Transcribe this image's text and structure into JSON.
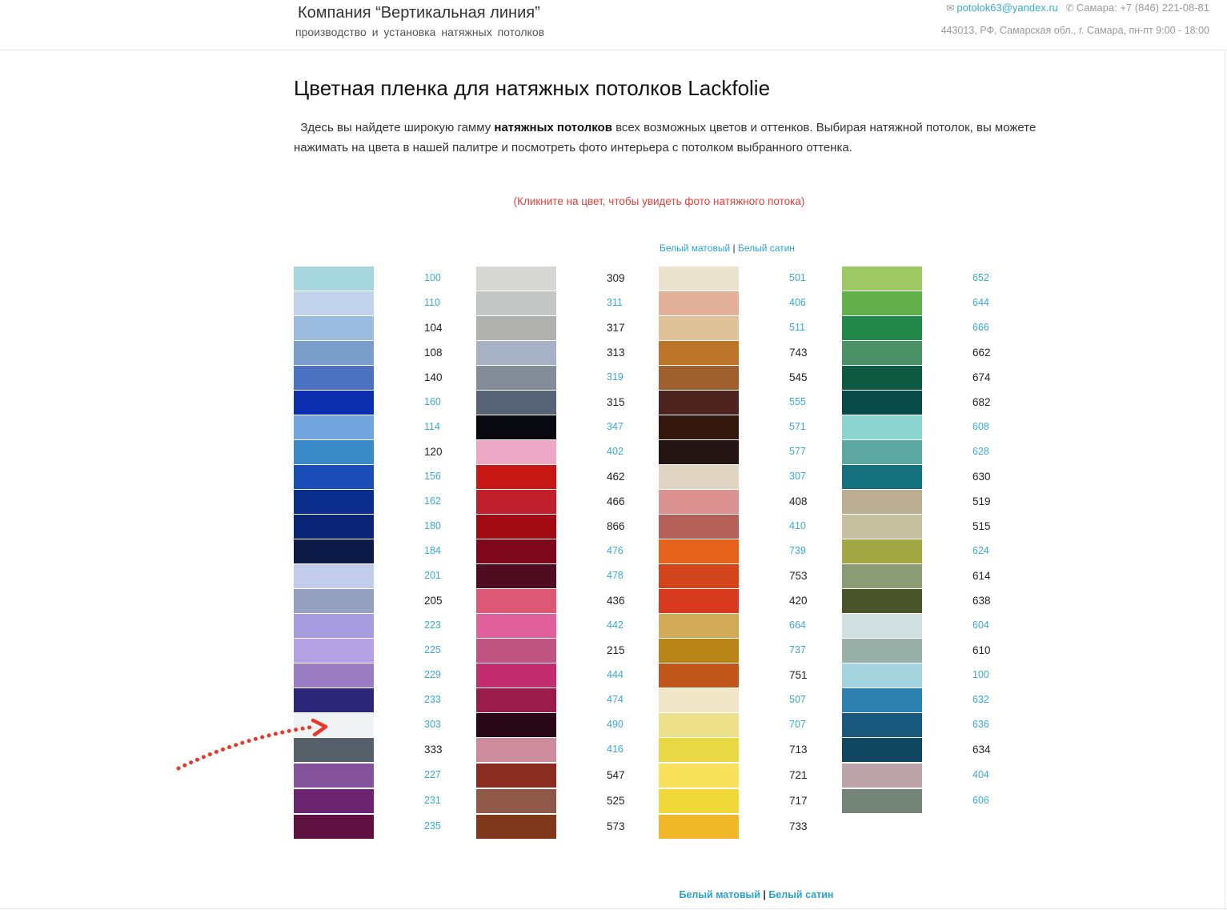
{
  "header": {
    "company": "Компания “Вертикальная линия”",
    "tagline": "производство и установка натяжных потолков",
    "email": "potolok63@yandex.ru",
    "phone": "Самара: +7 (846) 221-08-81",
    "address": "443013, РФ, Самарская обл., г. Самара, пн-пт 9:00 - 18:00"
  },
  "page": {
    "title": "Цветная пленка для натяжных потолков Lackfolie",
    "intro_before": "  Здесь вы найдете широкую гамму ",
    "intro_bold": "натяжных потолков",
    "intro_after": " всех возможных цветов и оттенков. Выбирая натяжной потолок, вы можете нажимать на цвета в нашей палитре и посмотреть фото интерьера с потолком выбранного оттенка.",
    "hint": "(Кликните на цвет, чтобы увидеть фото натяжного потока)",
    "white_matte": "Белый матовый",
    "white_satin": "Белый сатин",
    "separator": "|"
  },
  "palette": {
    "columns": [
      [
        {
          "code": "100",
          "color": "#a6d6de",
          "link": true
        },
        {
          "code": "110",
          "color": "#c2d3ec",
          "link": true
        },
        {
          "code": "104",
          "color": "#9cbce0",
          "link": false
        },
        {
          "code": "108",
          "color": "#7a9dc9",
          "link": false
        },
        {
          "code": "140",
          "color": "#4a72c0",
          "link": false
        },
        {
          "code": "160",
          "color": "#0e30b0",
          "link": true
        },
        {
          "code": "114",
          "color": "#72a4e0",
          "link": true
        },
        {
          "code": "120",
          "color": "#3a8ac8",
          "link": false
        },
        {
          "code": "156",
          "color": "#1a4db8",
          "link": true
        },
        {
          "code": "162",
          "color": "#0a2c8a",
          "link": true
        },
        {
          "code": "180",
          "color": "#0a2478",
          "link": true
        },
        {
          "code": "184",
          "color": "#0c1a48",
          "link": true
        },
        {
          "code": "201",
          "color": "#c2cdee",
          "link": true
        },
        {
          "code": "205",
          "color": "#94a0c0",
          "link": false
        },
        {
          "code": "223",
          "color": "#a89ce0",
          "link": true
        },
        {
          "code": "225",
          "color": "#b4a2e4",
          "link": true
        },
        {
          "code": "229",
          "color": "#9a7cc4",
          "link": true
        },
        {
          "code": "233",
          "color": "#2c2678",
          "link": true
        },
        {
          "code": "303",
          "color": "#f0f3f4",
          "link": true
        },
        {
          "code": "333",
          "color": "#56606a",
          "link": false
        },
        {
          "code": "227",
          "color": "#84529a",
          "link": true
        },
        {
          "code": "231",
          "color": "#6a2470",
          "link": true
        },
        {
          "code": "235",
          "color": "#5e1040",
          "link": true
        }
      ],
      [
        {
          "code": "309",
          "color": "#d6d6d4",
          "link": false
        },
        {
          "code": "311",
          "color": "#c4c6c6",
          "link": true
        },
        {
          "code": "317",
          "color": "#b0b0ae",
          "link": false
        },
        {
          "code": "313",
          "color": "#a6b2c4",
          "link": false
        },
        {
          "code": "319",
          "color": "#848c9a",
          "link": true
        },
        {
          "code": "315",
          "color": "#566476",
          "link": false
        },
        {
          "code": "347",
          "color": "#080a10",
          "link": true
        },
        {
          "code": "402",
          "color": "#eca8c4",
          "link": true
        },
        {
          "code": "462",
          "color": "#c81816",
          "link": false
        },
        {
          "code": "466",
          "color": "#c0202c",
          "link": false
        },
        {
          "code": "866",
          "color": "#a00a10",
          "link": false
        },
        {
          "code": "476",
          "color": "#80081c",
          "link": true
        },
        {
          "code": "478",
          "color": "#500c20",
          "link": true
        },
        {
          "code": "436",
          "color": "#dc5874",
          "link": false
        },
        {
          "code": "442",
          "color": "#e0609c",
          "link": true
        },
        {
          "code": "215",
          "color": "#c05480",
          "link": false
        },
        {
          "code": "444",
          "color": "#c42c70",
          "link": true
        },
        {
          "code": "474",
          "color": "#9a1c48",
          "link": true
        },
        {
          "code": "490",
          "color": "#280814",
          "link": true
        },
        {
          "code": "416",
          "color": "#cc8c9c",
          "link": true
        },
        {
          "code": "547",
          "color": "#8a2c20",
          "link": false
        },
        {
          "code": "525",
          "color": "#905848",
          "link": false
        },
        {
          "code": "573",
          "color": "#80381c",
          "link": false
        }
      ],
      [
        {
          "code": "501",
          "color": "#eae2cc",
          "link": true
        },
        {
          "code": "406",
          "color": "#e2b098",
          "link": true
        },
        {
          "code": "511",
          "color": "#e0c298",
          "link": true
        },
        {
          "code": "743",
          "color": "#bc7428",
          "link": false
        },
        {
          "code": "545",
          "color": "#a0602e",
          "link": false
        },
        {
          "code": "555",
          "color": "#4e2420",
          "link": true
        },
        {
          "code": "571",
          "color": "#34180e",
          "link": true
        },
        {
          "code": "577",
          "color": "#241414",
          "link": true
        },
        {
          "code": "307",
          "color": "#e0d4c2",
          "link": true
        },
        {
          "code": "408",
          "color": "#dc9290",
          "link": false
        },
        {
          "code": "410",
          "color": "#b46058",
          "link": true
        },
        {
          "code": "739",
          "color": "#e6621c",
          "link": true
        },
        {
          "code": "753",
          "color": "#d4441a",
          "link": false
        },
        {
          "code": "420",
          "color": "#d83a1e",
          "link": false
        },
        {
          "code": "664",
          "color": "#d2aa58",
          "link": true
        },
        {
          "code": "737",
          "color": "#b88418",
          "link": true
        },
        {
          "code": "751",
          "color": "#c0561a",
          "link": false
        },
        {
          "code": "507",
          "color": "#f0e6c8",
          "link": true
        },
        {
          "code": "707",
          "color": "#ece08a",
          "link": true
        },
        {
          "code": "713",
          "color": "#e8d844",
          "link": false
        },
        {
          "code": "721",
          "color": "#f8e25c",
          "link": false
        },
        {
          "code": "717",
          "color": "#f0d838",
          "link": false
        },
        {
          "code": "733",
          "color": "#f0b828",
          "link": false
        }
      ],
      [
        {
          "code": "652",
          "color": "#9ec864",
          "link": true
        },
        {
          "code": "644",
          "color": "#64b04c",
          "link": true
        },
        {
          "code": "666",
          "color": "#22884a",
          "link": true
        },
        {
          "code": "662",
          "color": "#4c9068",
          "link": false
        },
        {
          "code": "674",
          "color": "#0e5a40",
          "link": false
        },
        {
          "code": "682",
          "color": "#084a48",
          "link": false
        },
        {
          "code": "608",
          "color": "#8cd4d0",
          "link": true
        },
        {
          "code": "628",
          "color": "#5ca8a0",
          "link": true
        },
        {
          "code": "630",
          "color": "#14707c",
          "link": false
        },
        {
          "code": "519",
          "color": "#bcae92",
          "link": false
        },
        {
          "code": "515",
          "color": "#c4c0a0",
          "link": false
        },
        {
          "code": "624",
          "color": "#a4a844",
          "link": true
        },
        {
          "code": "614",
          "color": "#8a9c74",
          "link": false
        },
        {
          "code": "638",
          "color": "#4a5428",
          "link": false
        },
        {
          "code": "604",
          "color": "#d0e0e0",
          "link": true
        },
        {
          "code": "610",
          "color": "#98b0a8",
          "link": false
        },
        {
          "code": "100",
          "color": "#a4d4de",
          "link": true
        },
        {
          "code": "632",
          "color": "#2e80b0",
          "link": true
        },
        {
          "code": "636",
          "color": "#18587c",
          "link": true
        },
        {
          "code": "634",
          "color": "#104660",
          "link": false
        },
        {
          "code": "404",
          "color": "#bca4a8",
          "link": true
        },
        {
          "code": "606",
          "color": "#748478",
          "link": true
        }
      ]
    ]
  }
}
